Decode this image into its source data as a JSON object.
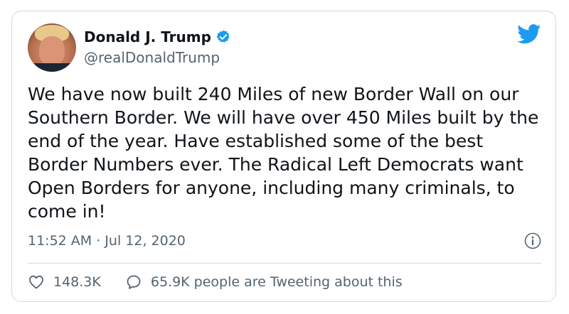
{
  "author": {
    "name": "Donald J. Trump",
    "handle": "@realDonaldTrump",
    "verified": true
  },
  "tweet": {
    "text": "We have now built 240 Miles of new Border Wall on our Southern Border. We will have over 450 Miles built by the end of the year. Have established some of the best Border Numbers ever. The Radical Left Democrats want Open Borders for anyone, including many criminals, to come in!",
    "timestamp": "11:52 AM · Jul 12, 2020"
  },
  "actions": {
    "likes": "148.3K",
    "conversation": "65.9K people are Tweeting about this"
  },
  "icons": {
    "logo": "twitter-bird-icon",
    "verified": "verified-badge-icon",
    "info": "info-icon",
    "like": "heart-icon",
    "reply": "speech-bubble-icon"
  },
  "colors": {
    "brand": "#1d9bf0",
    "text": "#0f1419",
    "secondary": "#536471",
    "border": "#cfd9de"
  }
}
